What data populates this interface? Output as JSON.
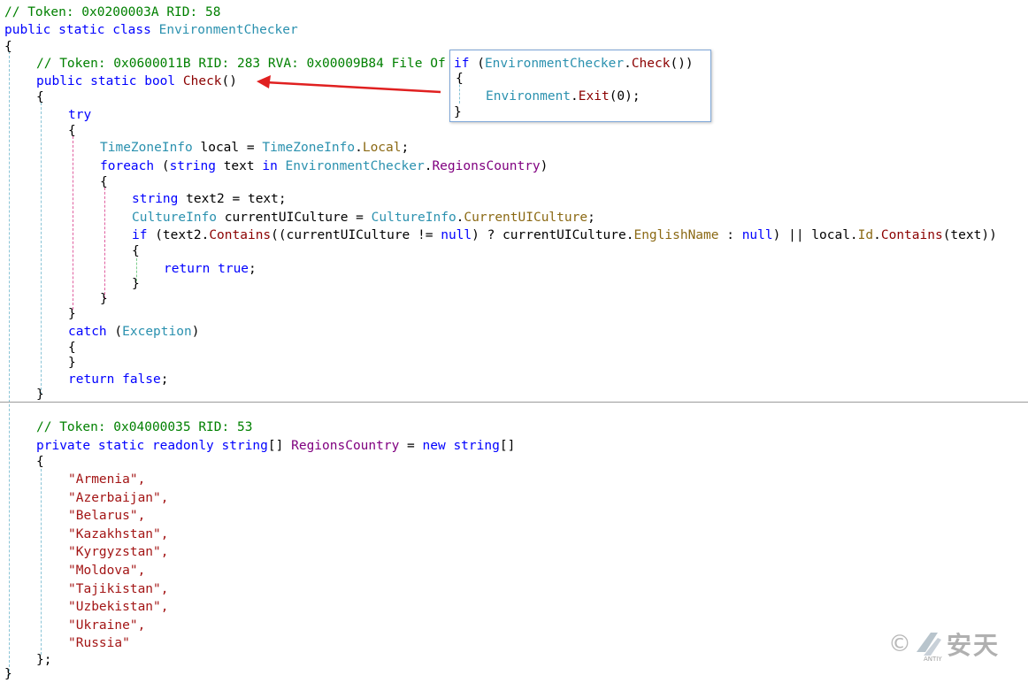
{
  "code": {
    "class_comment": "// Token: 0x0200003A RID: 58",
    "class_mods": "public static class",
    "class_name": "EnvironmentChecker",
    "open_brace": "{",
    "close_brace": "}",
    "method_comment": "// Token: 0x0600011B RID: 283 RVA: 0x00009B84 File Of",
    "method_mods": "public static bool",
    "method_name": "Check",
    "method_parens": "()",
    "try_kw": "try",
    "tz_type": "TimeZoneInfo",
    "tz_var": " local = ",
    "tz_type2": "TimeZoneInfo",
    "dot": ".",
    "tz_prop": "Local",
    "semi": ";",
    "foreach_kw": "foreach",
    "foreach_open": " (",
    "foreach_string": "string",
    "foreach_text": " text ",
    "foreach_in": "in",
    "foreach_class": " EnvironmentChecker",
    "foreach_field": "RegionsCountry",
    "foreach_close": ")",
    "s2_type": "string",
    "s2_rest": " text2 = text;",
    "ci_type": "CultureInfo",
    "ci_var": " currentUICulture = ",
    "ci_type2": "CultureInfo",
    "ci_prop": "CurrentUICulture",
    "if_kw": "if",
    "if_a": " (text2.",
    "if_contains": "Contains",
    "if_b": "((currentUICulture != ",
    "null_kw": "null",
    "if_c": ") ? currentUICulture.",
    "if_english": "EnglishName",
    "if_d": " : ",
    "if_e": ") || local.",
    "if_id": "Id",
    "if_f": "(text))",
    "return_kw": "return",
    "true_kw": " true",
    "catch_kw": "catch",
    "catch_open": " (",
    "catch_type": "Exception",
    "catch_close": ")",
    "false_kw": " false",
    "field_comment": "// Token: 0x04000035 RID: 53",
    "field_mods": "private static readonly string",
    "field_brackets": "[] ",
    "field_name": "RegionsCountry",
    "field_eq": " = ",
    "field_new": "new string",
    "field_end": "[]",
    "array_close": "};",
    "regions": [
      "\"Armenia\",",
      "\"Azerbaijan\",",
      "\"Belarus\",",
      "\"Kazakhstan\",",
      "\"Kyrgyzstan\",",
      "\"Moldova\",",
      "\"Tajikistan\",",
      "\"Uzbekistan\",",
      "\"Ukraine\",",
      "\"Russia\""
    ]
  },
  "popup": {
    "if_kw": "if",
    "open": " (",
    "class": "EnvironmentChecker",
    "dot": ".",
    "method": "Check",
    "close": "())",
    "brace_open": "{",
    "env": "Environment",
    "exit": "Exit",
    "arg": "(0);",
    "brace_close": "}"
  },
  "watermark": {
    "copyright": "©",
    "brand_cn": "安天",
    "brand_en": "ANTIY"
  },
  "colors": {
    "comment": "#008000",
    "keyword": "#0000ff",
    "type": "#2b91af",
    "method": "#8b0000",
    "string": "#a31515",
    "arrow": "#e02020"
  }
}
